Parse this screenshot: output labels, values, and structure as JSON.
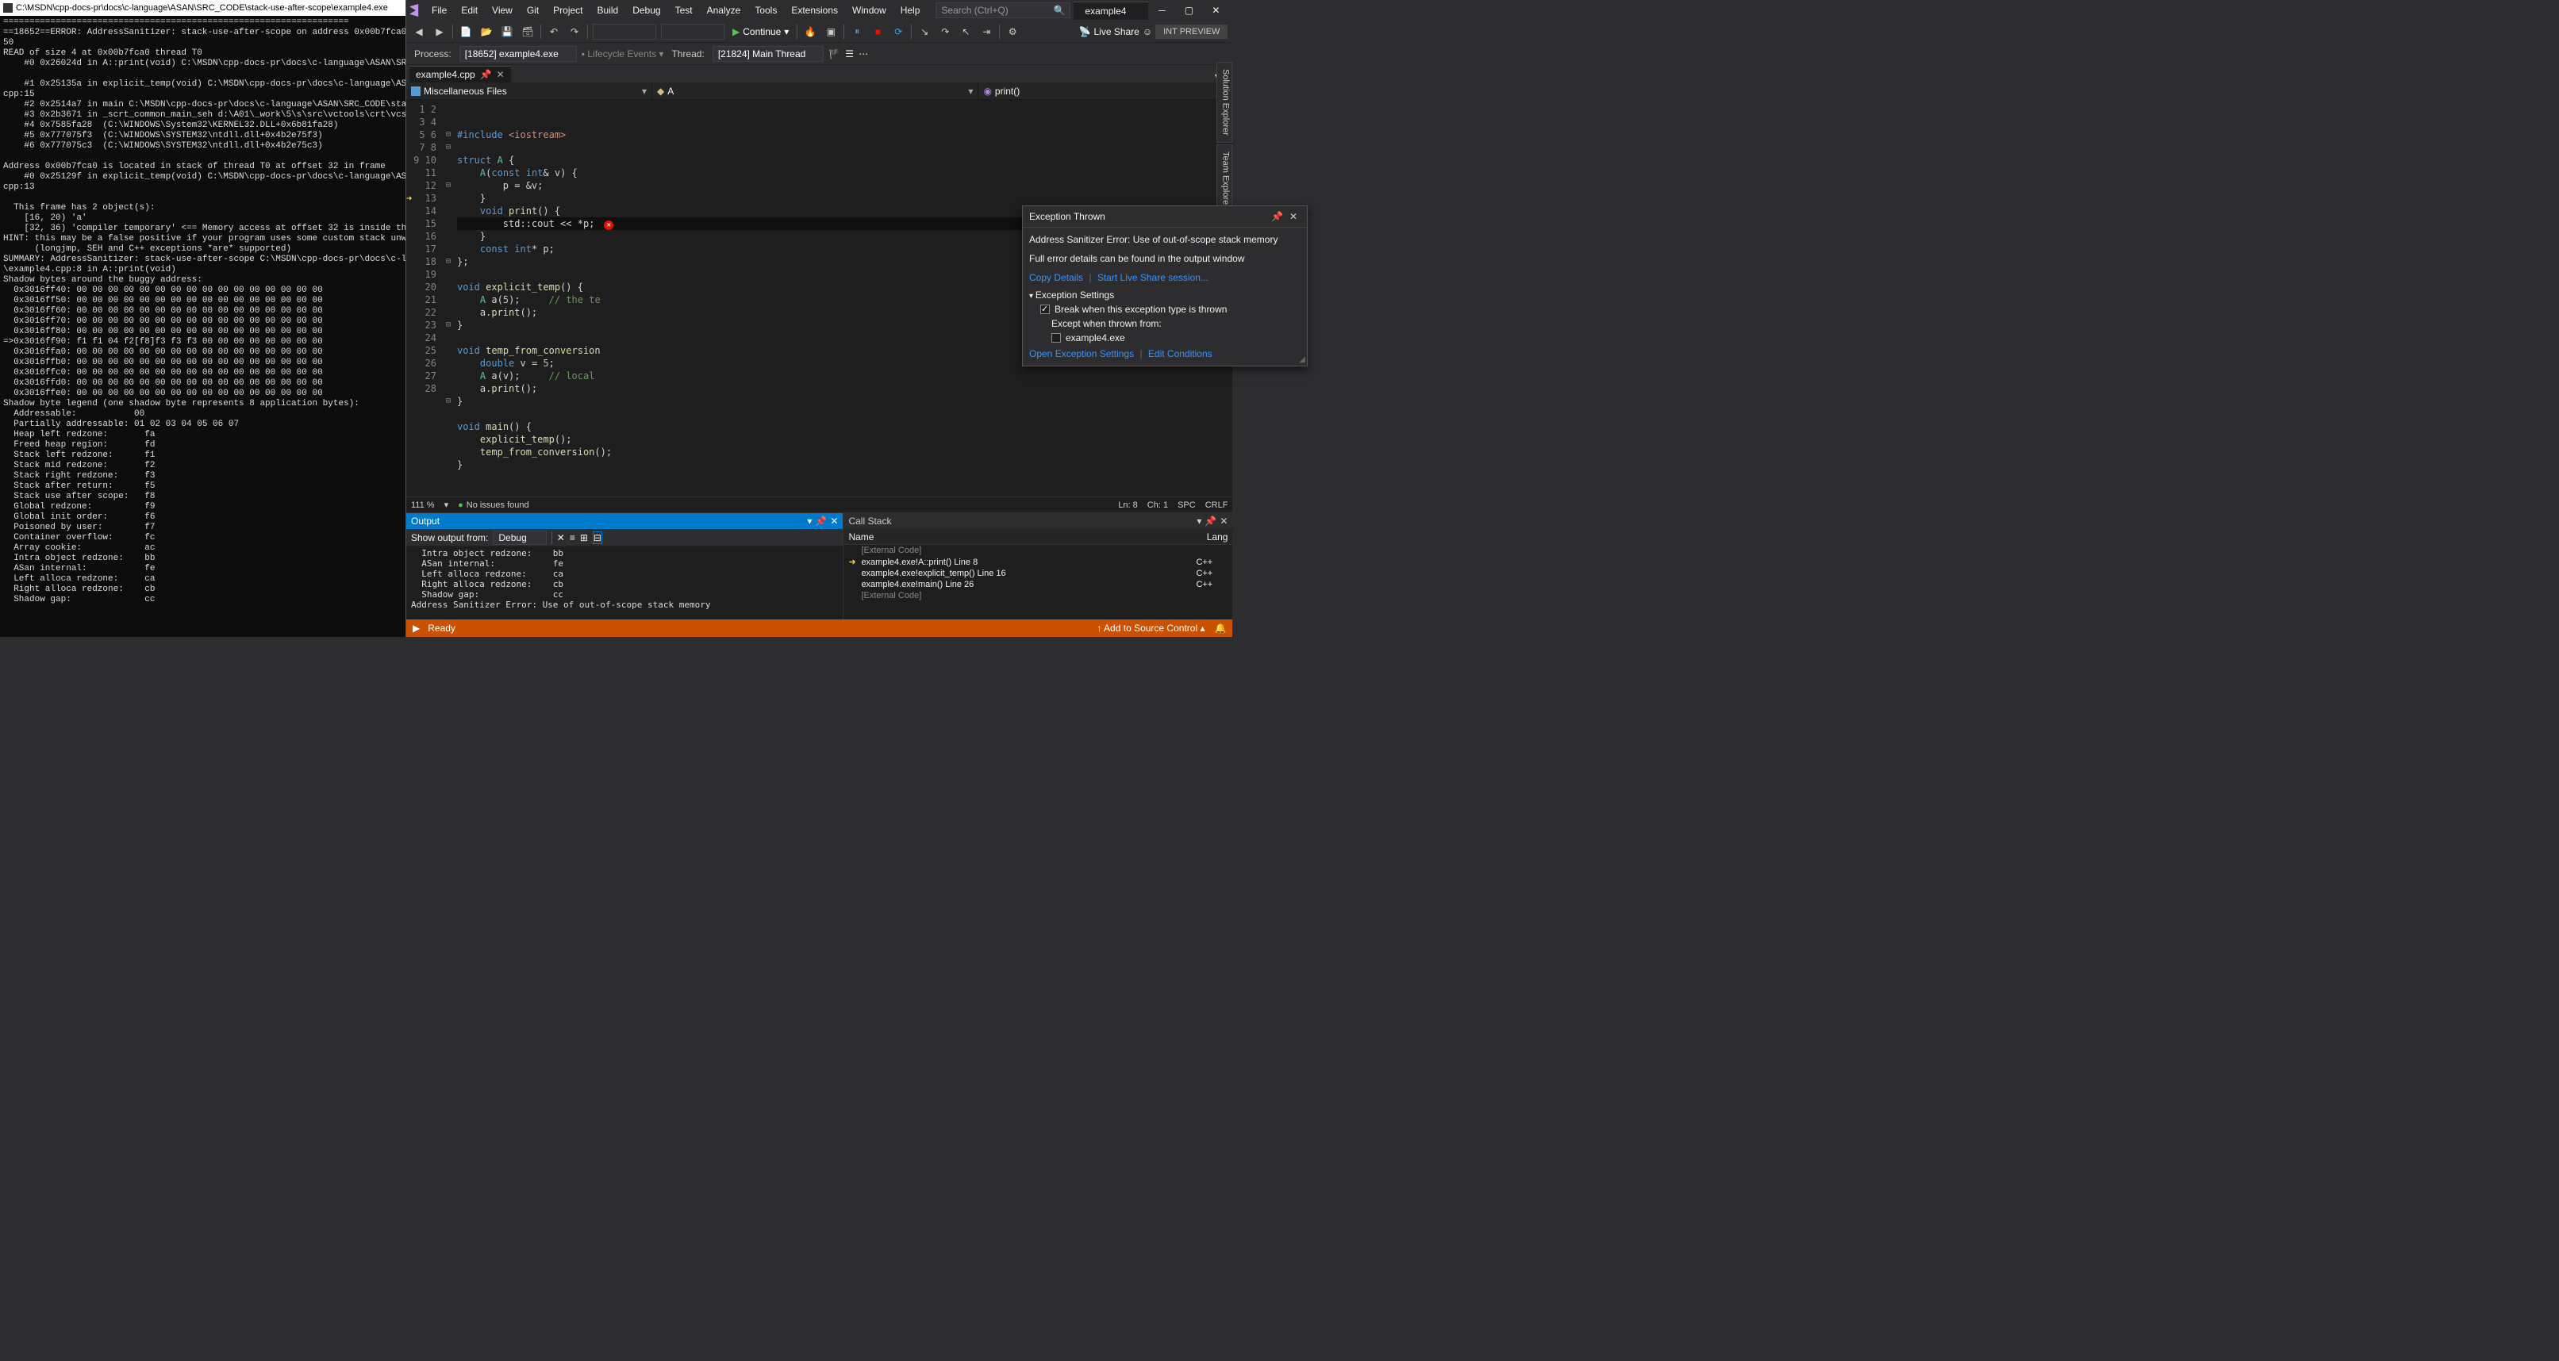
{
  "console": {
    "title": "C:\\MSDN\\cpp-docs-pr\\docs\\c-language\\ASAN\\SRC_CODE\\stack-use-after-scope\\example4.exe",
    "body": "==================================================================\n==18652==ERROR: AddressSanitizer: stack-use-after-scope on address 0x00b7fca0 at pc\n50\nREAD of size 4 at 0x00b7fca0 thread T0\n    #0 0x26024d in A::print(void) C:\\MSDN\\cpp-docs-pr\\docs\\c-language\\ASAN\\SRC_CODE\n\n    #1 0x25135a in explicit_temp(void) C:\\MSDN\\cpp-docs-pr\\docs\\c-language\\ASAN\\SRC_\ncpp:15\n    #2 0x2514a7 in main C:\\MSDN\\cpp-docs-pr\\docs\\c-language\\ASAN\\SRC_CODE\\stack-use-\n    #3 0x2b3671 in _scrt_common_main_seh d:\\A01\\_work\\5\\s\\src\\vctools\\crt\\vcstartup\\\n    #4 0x7585fa28  (C:\\WINDOWS\\System32\\KERNEL32.DLL+0x6b81fa28)\n    #5 0x777075f3  (C:\\WINDOWS\\SYSTEM32\\ntdll.dll+0x4b2e75f3)\n    #6 0x777075c3  (C:\\WINDOWS\\SYSTEM32\\ntdll.dll+0x4b2e75c3)\n\nAddress 0x00b7fca0 is located in stack of thread T0 at offset 32 in frame\n    #0 0x25129f in explicit_temp(void) C:\\MSDN\\cpp-docs-pr\\docs\\c-language\\ASAN\\SRC_\ncpp:13\n\n  This frame has 2 object(s):\n    [16, 20) 'a'\n    [32, 36) 'compiler temporary' <== Memory access at offset 32 is inside this vari\nHINT: this may be a false positive if your program uses some custom stack unwind mec\n      (longjmp, SEH and C++ exceptions *are* supported)\nSUMMARY: AddressSanitizer: stack-use-after-scope C:\\MSDN\\cpp-docs-pr\\docs\\c-language\n\\example4.cpp:8 in A::print(void)\nShadow bytes around the buggy address:\n  0x3016ff40: 00 00 00 00 00 00 00 00 00 00 00 00 00 00 00 00\n  0x3016ff50: 00 00 00 00 00 00 00 00 00 00 00 00 00 00 00 00\n  0x3016ff60: 00 00 00 00 00 00 00 00 00 00 00 00 00 00 00 00\n  0x3016ff70: 00 00 00 00 00 00 00 00 00 00 00 00 00 00 00 00\n  0x3016ff80: 00 00 00 00 00 00 00 00 00 00 00 00 00 00 00 00\n=>0x3016ff90: f1 f1 04 f2[f8]f3 f3 f3 00 00 00 00 00 00 00 00\n  0x3016ffa0: 00 00 00 00 00 00 00 00 00 00 00 00 00 00 00 00\n  0x3016ffb0: 00 00 00 00 00 00 00 00 00 00 00 00 00 00 00 00\n  0x3016ffc0: 00 00 00 00 00 00 00 00 00 00 00 00 00 00 00 00\n  0x3016ffd0: 00 00 00 00 00 00 00 00 00 00 00 00 00 00 00 00\n  0x3016ffe0: 00 00 00 00 00 00 00 00 00 00 00 00 00 00 00 00\nShadow byte legend (one shadow byte represents 8 application bytes):\n  Addressable:           00\n  Partially addressable: 01 02 03 04 05 06 07\n  Heap left redzone:       fa\n  Freed heap region:       fd\n  Stack left redzone:      f1\n  Stack mid redzone:       f2\n  Stack right redzone:     f3\n  Stack after return:      f5\n  Stack use after scope:   f8\n  Global redzone:          f9\n  Global init order:       f6\n  Poisoned by user:        f7\n  Container overflow:      fc\n  Array cookie:            ac\n  Intra object redzone:    bb\n  ASan internal:           fe\n  Left alloca redzone:     ca\n  Right alloca redzone:    cb\n  Shadow gap:              cc"
  },
  "vs": {
    "menus": [
      "File",
      "Edit",
      "View",
      "Git",
      "Project",
      "Build",
      "Debug",
      "Test",
      "Analyze",
      "Tools",
      "Extensions",
      "Window",
      "Help"
    ],
    "search_placeholder": "Search (Ctrl+Q)",
    "solution_name": "example4",
    "continue_label": "Continue",
    "liveshare_label": "Live Share",
    "int_preview": "INT PREVIEW",
    "process_label": "Process:",
    "process_value": "[18652] example4.exe",
    "lifecycle_label": "Lifecycle Events",
    "thread_label": "Thread:",
    "thread_value": "[21824] Main Thread",
    "tab_name": "example4.cpp",
    "nav_scope": "Miscellaneous Files",
    "nav_class": "A",
    "nav_member": "print()",
    "zoom": "111 %",
    "no_issues": "No issues found",
    "ln": "Ln: 8",
    "ch": "Ch: 1",
    "spc": "SPC",
    "crlf": "CRLF",
    "code_lines": {
      "1": "#include <iostream>",
      "2": "",
      "3": "struct A {",
      "4": "    A(const int& v) {",
      "5": "        p = &v;",
      "6": "    }",
      "7": "    void print() {",
      "8": "        std::cout << *p;",
      "9": "    }",
      "10": "    const int* p;",
      "11": "};",
      "12": "",
      "13": "void explicit_temp() {",
      "14": "    A a(5);     // the te",
      "15": "    a.print();",
      "16": "}",
      "17": "",
      "18": "void temp_from_conversion",
      "19": "    double v = 5;",
      "20": "    A a(v);     // local ",
      "21": "    a.print();",
      "22": "}",
      "23": "",
      "24": "void main() {",
      "25": "    explicit_temp();",
      "26": "    temp_from_conversion();",
      "27": "}",
      "28": ""
    },
    "exception": {
      "title": "Exception Thrown",
      "message": "Address Sanitizer Error: Use of out-of-scope stack memory",
      "detail": "Full error details can be found in the output window",
      "copy": "Copy Details",
      "liveshare": "Start Live Share session...",
      "settings_title": "Exception Settings",
      "break_when": "Break when this exception type is thrown",
      "except_when": "Except when thrown from:",
      "except_item": "example4.exe",
      "open_settings": "Open Exception Settings",
      "edit_cond": "Edit Conditions"
    },
    "output": {
      "title": "Output",
      "show_from": "Show output from:",
      "source": "Debug",
      "body": "  Intra object redzone:    bb\n  ASan internal:           fe\n  Left alloca redzone:     ca\n  Right alloca redzone:    cb\n  Shadow gap:              cc\nAddress Sanitizer Error: Use of out-of-scope stack memory"
    },
    "callstack": {
      "title": "Call Stack",
      "col_name": "Name",
      "col_lang": "Lang",
      "rows": [
        {
          "name": "[External Code]",
          "lang": "",
          "ext": true,
          "cur": false
        },
        {
          "name": "example4.exe!A::print() Line 8",
          "lang": "C++",
          "ext": false,
          "cur": true
        },
        {
          "name": "example4.exe!explicit_temp() Line 16",
          "lang": "C++",
          "ext": false,
          "cur": false
        },
        {
          "name": "example4.exe!main() Line 26",
          "lang": "C++",
          "ext": false,
          "cur": false
        },
        {
          "name": "[External Code]",
          "lang": "",
          "ext": true,
          "cur": false
        }
      ]
    },
    "statusbar": {
      "ready": "Ready",
      "add_src": "Add to Source Control"
    },
    "vert_tabs": [
      "Solution Explorer",
      "Team Explorer"
    ]
  }
}
